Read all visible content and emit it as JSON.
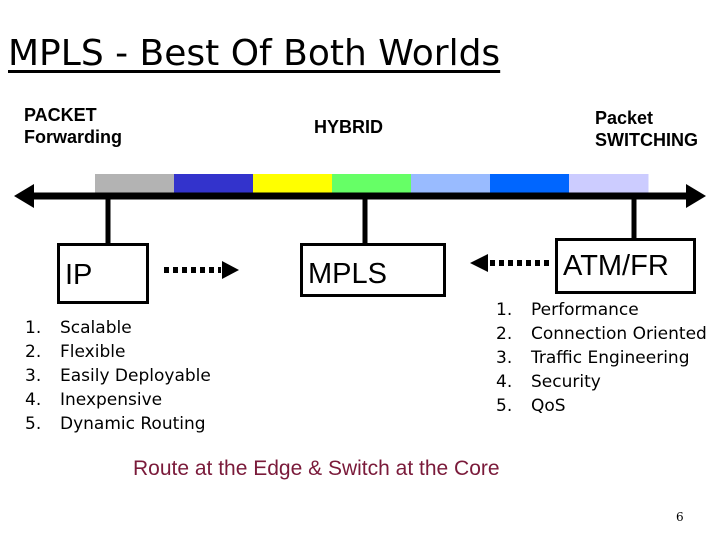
{
  "slide": {
    "title": "MPLS - Best Of Both Worlds",
    "page_number": "6"
  },
  "spectrum": {
    "left_label": "PACKET\nForwarding",
    "middle_label": "HYBRID",
    "right_label": "Packet\nSWITCHING",
    "color_bands": [
      "#b3b3b3",
      "#3333cc",
      "#ffff00",
      "#66ff66",
      "#99bbff",
      "#0066ff",
      "#ccccff"
    ]
  },
  "technologies": {
    "ip": "IP",
    "mpls": "MPLS",
    "atm_fr": "ATM/FR"
  },
  "ip_benefits": [
    {
      "num": "1.",
      "text": "Scalable"
    },
    {
      "num": "2.",
      "text": "Flexible"
    },
    {
      "num": "3.",
      "text": "Easily Deployable"
    },
    {
      "num": "4.",
      "text": "Inexpensive"
    },
    {
      "num": "5.",
      "text": "Dynamic Routing"
    }
  ],
  "atm_benefits": [
    {
      "num": "1.",
      "text": "Performance"
    },
    {
      "num": "2.",
      "text": "Connection Oriented"
    },
    {
      "num": "3.",
      "text": "Traffic Engineering"
    },
    {
      "num": "4.",
      "text": "Security"
    },
    {
      "num": "5.",
      "text": "QoS"
    }
  ],
  "tagline": "Route at the Edge & Switch at the Core",
  "colors": {
    "tagline": "#7a1a3a",
    "line": "#000000"
  }
}
